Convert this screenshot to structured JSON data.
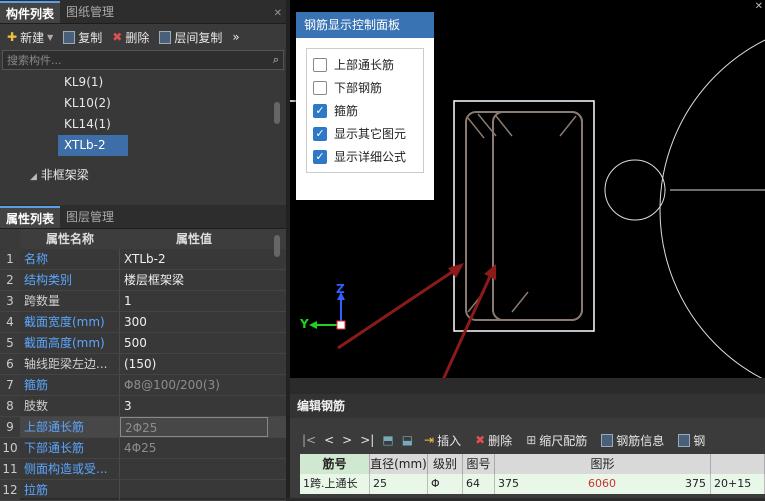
{
  "component_panel": {
    "tabs": [
      {
        "label": "构件列表"
      },
      {
        "label": "图纸管理"
      }
    ],
    "toolbar": {
      "new": "新建",
      "copy": "复制",
      "delete": "删除",
      "floor_copy": "层间复制",
      "more": "»"
    },
    "search_placeholder": "搜索构件...",
    "tree": [
      {
        "label": "KL9(1)"
      },
      {
        "label": "KL10(2)"
      },
      {
        "label": "KL14(1)"
      },
      {
        "label": "XTLb-2",
        "selected": true
      },
      {
        "label": "非框架梁",
        "group": true
      }
    ]
  },
  "property_panel": {
    "tabs": [
      {
        "label": "属性列表"
      },
      {
        "label": "图层管理"
      }
    ],
    "header": {
      "name": "属性名称",
      "value": "属性值"
    },
    "rows": [
      {
        "num": "1",
        "name": "名称",
        "value": "XTLb-2"
      },
      {
        "num": "2",
        "name": "结构类别",
        "value": "楼层框架梁"
      },
      {
        "num": "3",
        "name": "跨数量",
        "value": "1"
      },
      {
        "num": "4",
        "name": "截面宽度(mm)",
        "value": "300"
      },
      {
        "num": "5",
        "name": "截面高度(mm)",
        "value": "500"
      },
      {
        "num": "6",
        "name": "轴线距梁左边...",
        "value": "(150)"
      },
      {
        "num": "7",
        "name": "箍筋",
        "value": "Φ8@100/200(3)"
      },
      {
        "num": "8",
        "name": "肢数",
        "value": "3"
      },
      {
        "num": "9",
        "name": "上部通长筋",
        "value": "2Φ25"
      },
      {
        "num": "10",
        "name": "下部通长筋",
        "value": "4Φ25"
      },
      {
        "num": "11",
        "name": "侧面构造或受...",
        "value": ""
      },
      {
        "num": "12",
        "name": "拉筋",
        "value": ""
      }
    ]
  },
  "control_panel": {
    "title": "钢筋显示控制面板",
    "options": [
      {
        "label": "上部通长筋",
        "checked": false
      },
      {
        "label": "下部钢筋",
        "checked": false
      },
      {
        "label": "箍筋",
        "checked": true
      },
      {
        "label": "显示其它图元",
        "checked": true
      },
      {
        "label": "显示详细公式",
        "checked": true
      }
    ]
  },
  "axes": {
    "z": "Z",
    "y": "Y"
  },
  "rebar_editor": {
    "title": "编辑钢筋",
    "tools": {
      "insert": "插入",
      "delete": "删除",
      "scale": "缩尺配筋",
      "info": "钢筋信息",
      "lib": "钢"
    },
    "columns": [
      "筋号",
      "直径(mm)",
      "级别",
      "图号",
      "图形"
    ],
    "row": {
      "name": "1跨.上通长",
      "diameter": "25",
      "grade": "Φ",
      "fig": "64",
      "dim1": "375",
      "dim2": "6060",
      "dim3": "375",
      "extra": "20+15"
    }
  },
  "colors": {
    "accent": "#3a73b4",
    "link": "#5aa6ff",
    "arrow": "#8b1a1a"
  }
}
